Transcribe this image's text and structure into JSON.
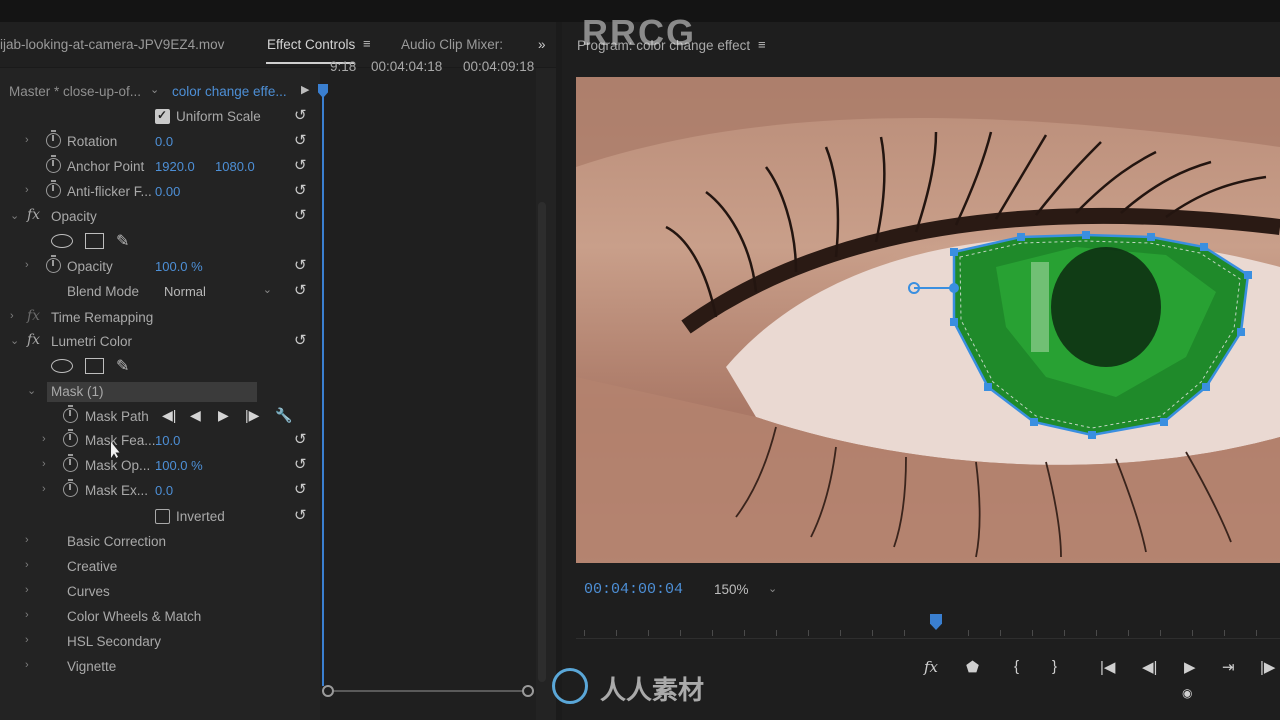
{
  "tabs": {
    "source_clip": "ijab-looking-at-camera-JPV9EZ4.mov",
    "effect_controls": "Effect Controls",
    "menu_glyph": "≡",
    "audio_mixer": "Audio Clip Mixer:",
    "overflow": "»"
  },
  "master": {
    "name": "Master * close-up-of...",
    "clip": "color change effe...",
    "caret": "⌄",
    "play": "▶"
  },
  "timeline": {
    "times": [
      "9:18",
      "00:04:04:18",
      "00:04:09:18"
    ]
  },
  "effects": {
    "uniform_scale": "Uniform Scale",
    "rotation_label": "Rotation",
    "rotation_value": "0.0",
    "anchor_label": "Anchor Point",
    "anchor_x": "1920.0",
    "anchor_y": "1080.0",
    "antiflicker_label": "Anti-flicker F...",
    "antiflicker_value": "0.00",
    "opacity_section": "Opacity",
    "opacity_label": "Opacity",
    "opacity_value": "100.0 %",
    "blend_label": "Blend Mode",
    "blend_value": "Normal",
    "time_remap": "Time Remapping",
    "lumetri": "Lumetri Color",
    "mask": "Mask (1)",
    "mask_path": "Mask Path",
    "mask_feather_label": "Mask Fea...",
    "mask_feather_value": "10.0",
    "mask_opacity_label": "Mask Op...",
    "mask_opacity_value": "100.0 %",
    "mask_expansion_label": "Mask Ex...",
    "mask_expansion_value": "0.0",
    "inverted": "Inverted",
    "basic_correction": "Basic Correction",
    "creative": "Creative",
    "curves": "Curves",
    "color_wheels": "Color Wheels & Match",
    "hsl": "HSL Secondary",
    "vignette": "Vignette",
    "fx": "fx",
    "reset_glyph": "↺",
    "chev_right": "›",
    "chev_down": "⌄"
  },
  "mask_path_controls": [
    "◀|",
    "◀",
    "▶",
    "|▶",
    "🔧"
  ],
  "program": {
    "title": "Program: color change effect",
    "menu_glyph": "≡",
    "timecode": "00:04:00:04",
    "zoom": "150%",
    "zoom_caret": "⌄"
  },
  "transport": [
    "fx",
    "⬟",
    "{",
    "}",
    "|◀",
    "◀|",
    "▶",
    "⇥",
    "|▶",
    "◉"
  ],
  "watermarks": {
    "top": "RRCG",
    "bottom": "人人素材"
  },
  "colors": {
    "accent_blue": "#4d8fd6",
    "mask_blue": "#3a8fe0",
    "iris_green": "#1f8a2a"
  }
}
